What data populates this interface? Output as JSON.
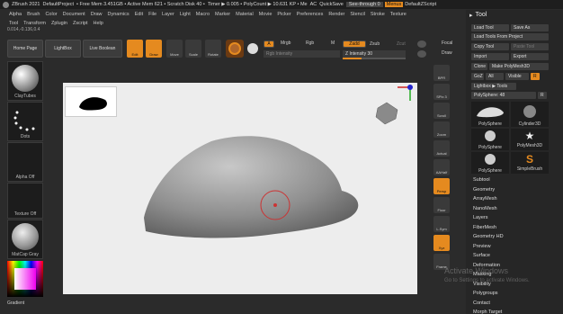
{
  "titlebar": {
    "items": [
      "ZBrush 2021",
      "DefaultProject",
      "• Free Mem 3.451GB • Active Mem 621 • Scratch Disk 40 •",
      "Timer ▶ 0.005 • PolyCount ▶ 10.631 KP • Me",
      "AC",
      "QuickSave"
    ],
    "see_through": "See-through 0",
    "menus": "Menus",
    "default_script": "DefaultZScript"
  },
  "menubar": [
    "Alpha",
    "Brush",
    "Color",
    "Document",
    "Draw",
    "Dynamics",
    "Edit",
    "File",
    "Layer",
    "Light",
    "Macro",
    "Marker",
    "Material",
    "Movie",
    "Picker",
    "Preferences",
    "Render",
    "Stencil",
    "Stroke",
    "Texture"
  ],
  "menubar2": [
    "Tool",
    "Transform",
    "Zplugin",
    "Zscript",
    "Help"
  ],
  "infoline": "0.014,-0.136,0.4",
  "toolbar": {
    "home_page": "Home Page",
    "lightbox": "LightBox",
    "live_boolean": "Live Boolean",
    "edit": "Edit",
    "draw": "Draw",
    "move": "Move",
    "scale": "Scale",
    "rotate": "Rotate",
    "a_label": "A",
    "mrgb": "Mrgb",
    "rgb": "Rgb",
    "m": "M",
    "zadd": "Zadd",
    "zsub": "Zsub",
    "zcut": "Zcut",
    "rgb_intensity": "Rgb Intensity",
    "z_intensity": "Z Intensity 30",
    "focal": "Focal",
    "draw_size": "Draw"
  },
  "leftcol": {
    "brush": "ClayTubes",
    "stroke": "Dots",
    "alpha": "Alpha Off",
    "texture": "Texture Off",
    "material": "MatCap Gray",
    "gradient": "Gradient"
  },
  "rightstrip": [
    "BPR",
    "SPix 3",
    "Scroll",
    "Zoom",
    "Actual",
    "AAHalf",
    "Persp",
    "Floor",
    "L.Sym",
    "Xyz",
    "Frame"
  ],
  "palette": {
    "title": "Tool",
    "load_tool": "Load Tool",
    "save_as": "Save As",
    "load_from_project": "Load Tools From Project",
    "copy_tool": "Copy Tool",
    "paste_tool": "Paste Tool",
    "import": "Import",
    "export": "Export",
    "clone": "Clone",
    "make_polymesh": "Make PolyMesh3D",
    "goz": "GoZ",
    "all": "All",
    "visible": "Visible",
    "r": "R",
    "lightbox_tools": "Lightbox ▶ Tools",
    "polysphere_count": "PolySphere: 48",
    "r2": "R",
    "thumbs": [
      "PolySphere",
      "Cylinder3D",
      "PolySphere",
      "PolyMesh3D",
      "PolySphere",
      "SimpleBrush"
    ],
    "submenus": [
      "Subtool",
      "Geometry",
      "ArrayMesh",
      "NanoMesh",
      "Layers",
      "FiberMesh",
      "Geometry HD",
      "Preview",
      "Surface",
      "Deformation",
      "Masking",
      "Visibility",
      "Polygroups",
      "Contact",
      "Morph Target"
    ]
  },
  "watermark": {
    "line1": "Activate Windows",
    "line2": "Go to Settings to activate Windows."
  },
  "colors": {
    "accent": "#e58a1f",
    "canvas": "#ededed",
    "model": "#8e8e8e"
  }
}
